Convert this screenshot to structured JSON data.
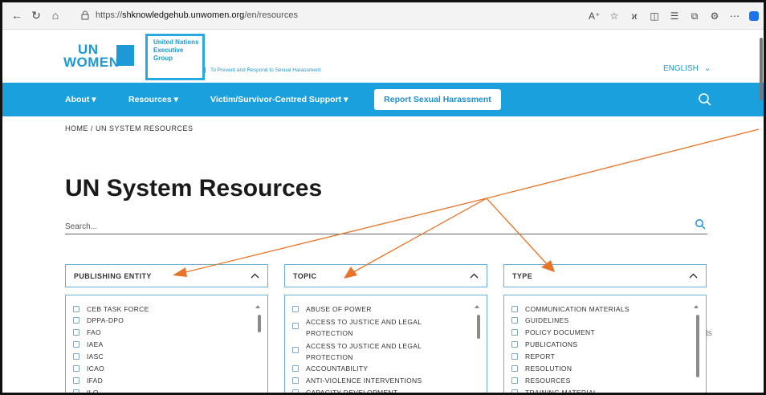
{
  "browser": {
    "url_prefix": "https://",
    "url_host": "shknowledgehub.unwomen.org",
    "url_path": "/en/resources"
  },
  "header": {
    "logo_line1": "UN",
    "logo_line2": "WOMEN",
    "unceg_line1": "United Nations",
    "unceg_line2": "Executive",
    "unceg_line3": "Group",
    "tagline": "To Prevent and Respond to Sexual Harassment",
    "language": "ENGLISH"
  },
  "nav": {
    "about": "About ▾",
    "resources": "Resources ▾",
    "support": "Victim/Survivor-Centred Support ▾",
    "report": "Report Sexual Harassment"
  },
  "breadcrumb": "HOME / UN SYSTEM RESOURCES",
  "page_title": "UN System Resources",
  "search": {
    "placeholder": "Search..."
  },
  "filters": {
    "publishing_entity": {
      "label": "PUBLISHING ENTITY",
      "options": [
        "CEB TASK FORCE",
        "DPPA-DPO",
        "FAO",
        "IAEA",
        "IASC",
        "ICAO",
        "IFAD",
        "ILO"
      ]
    },
    "topic": {
      "label": "TOPIC",
      "options": [
        "ABUSE OF POWER",
        "ACCESS TO JUSTICE AND LEGAL PROTECTION",
        "ACCESS TO JUSTICE AND LEGAL PROTECTION",
        "ACCOUNTABILITY",
        "ANTI-VIOLENCE INTERVENTIONS",
        "CAPACITY DEVELOPMENT"
      ]
    },
    "type": {
      "label": "TYPE",
      "options": [
        "COMMUNICATION MATERIALS",
        "GUIDELINES",
        "POLICY DOCUMENT",
        "PUBLICATIONS",
        "REPORT",
        "RESOLUTION",
        "RESOURCES",
        "TRAINING MATERIAL"
      ]
    }
  },
  "stray_text": "ts",
  "colors": {
    "brand": "#1aa0dc",
    "annotation_arrow": "#e8742a"
  }
}
